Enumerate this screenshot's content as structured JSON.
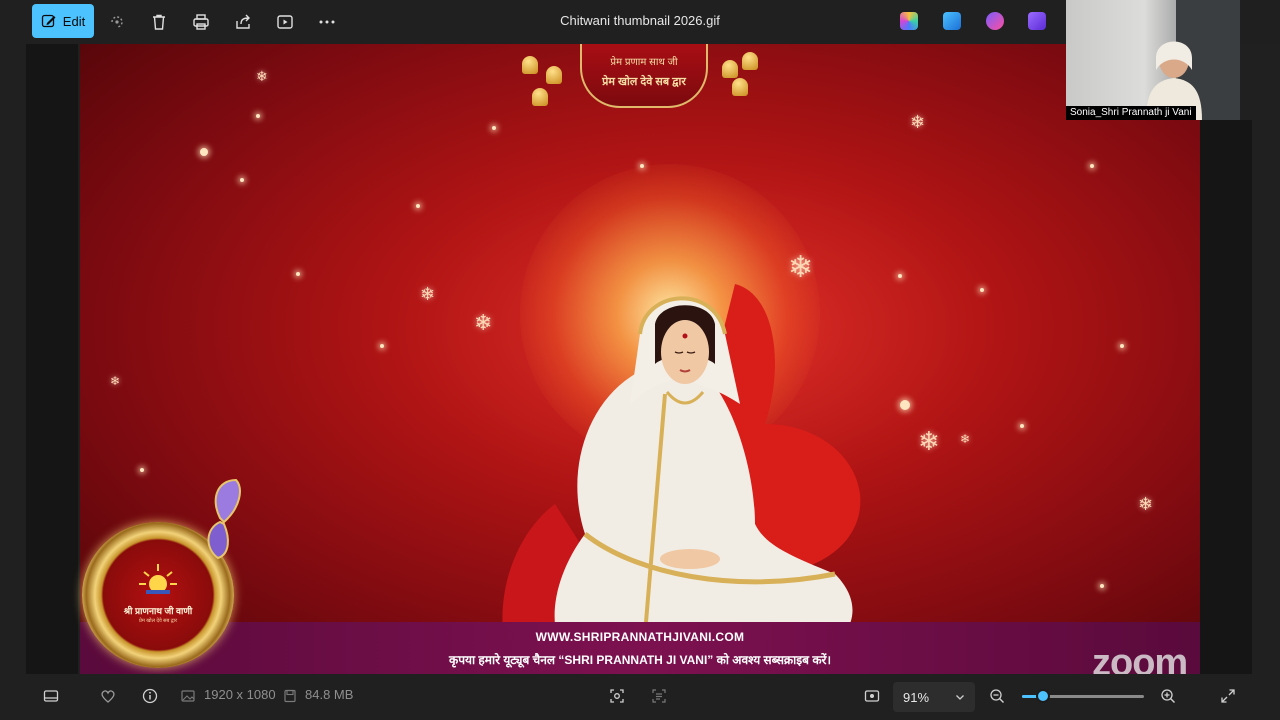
{
  "toolbar": {
    "edit_label": "Edit",
    "file_title": "Chitwani thumbnail 2026.gif",
    "colors": {
      "edit_bg": "#4cc2ff",
      "toolbar_bg": "#202020"
    }
  },
  "image": {
    "banner_line1": "प्रेम प्रणाम साथ जी",
    "banner_line2": "प्रेम खोल देवे सब द्वार",
    "url": "WWW.SHRIPRANNATHJIVANI.COM",
    "message": "कृपया हमारे यूट्यूब चैनल “SHRI PRANNATH JI VANI” को अवश्य सब्सक्राइब करें।",
    "logo_title": "श्री प्राणनाथ जी वाणी",
    "logo_sub": "प्रेम खोल देवे सब द्वार"
  },
  "participant": {
    "name": "Sonia_Shri Prannath ji Vani"
  },
  "zoom_watermark": "zoom",
  "statusbar": {
    "dimensions": "1920 x 1080",
    "file_size": "84.8 MB",
    "zoom_level": "91%",
    "zoom_fraction": 0.17
  }
}
